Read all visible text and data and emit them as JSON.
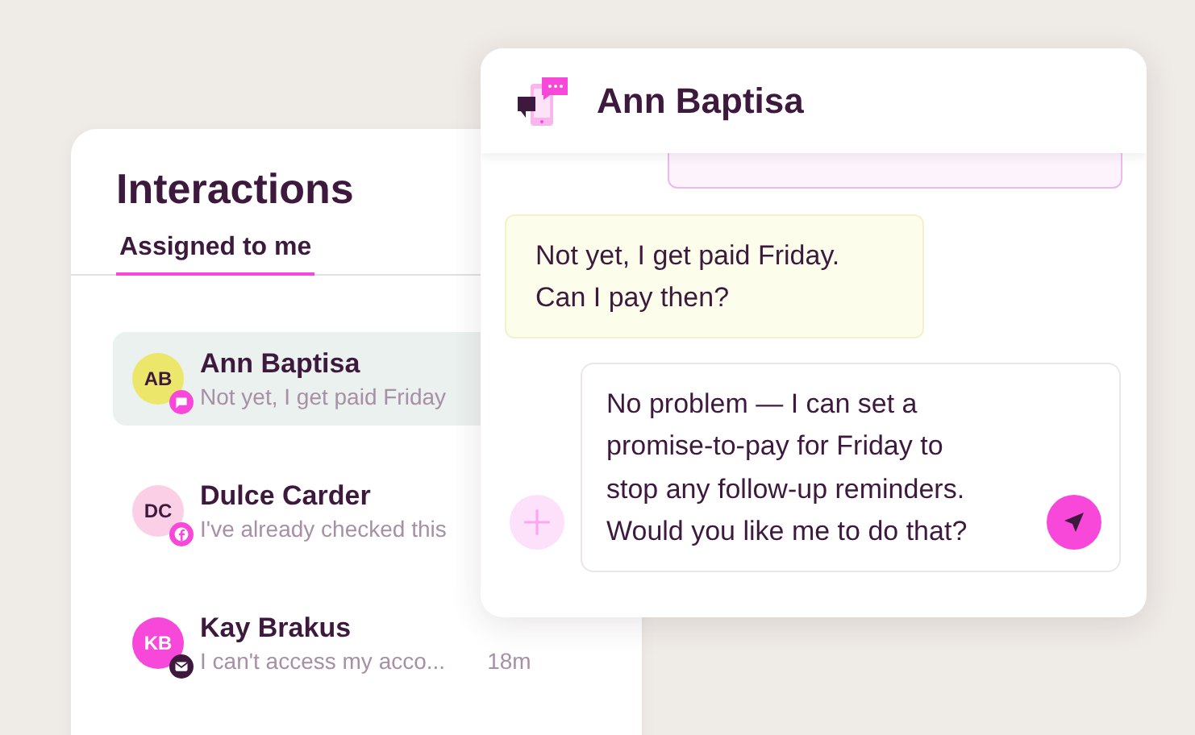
{
  "conversation_list": {
    "title": "Interactions",
    "tabs": [
      {
        "label": "Assigned to me",
        "selected": true
      }
    ],
    "items": [
      {
        "initials": "AB",
        "name": "Ann Baptisa",
        "preview": "Not yet, I get paid Friday",
        "color": "#ece76a",
        "kind": "chat",
        "selected": true
      },
      {
        "initials": "DC",
        "name": "Dulce Carder",
        "preview": "I've already checked this",
        "color": "#fbd0e6",
        "kind": "facebook",
        "selected": false
      },
      {
        "initials": "KB",
        "name": "Kay Brakus",
        "preview": "I can't access my acco...",
        "color": "#f748d9",
        "kind": "email",
        "time": "18m",
        "selected": false
      }
    ]
  },
  "chat": {
    "contact_name": "Ann Baptisa",
    "messages": [
      {
        "kind": "agent"
      },
      {
        "kind": "customer",
        "text": "Not yet, I get paid Friday.\nCan I pay then?"
      }
    ],
    "composer": {
      "value": "No problem — I can set a promise-to-pay for Friday to stop any follow-up reminders. Would you like me to do that?"
    }
  }
}
